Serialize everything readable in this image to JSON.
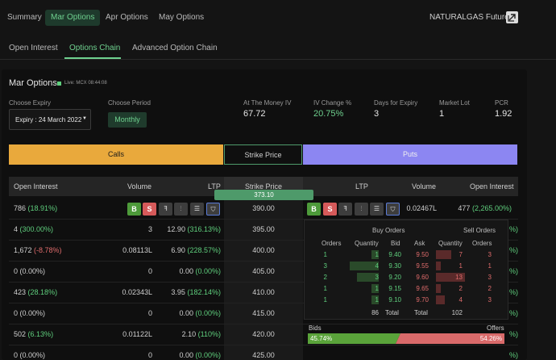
{
  "top_tabs": [
    {
      "label": "Summary"
    },
    {
      "label": "Mar Options"
    },
    {
      "label": "Apr Options"
    },
    {
      "label": "May Options"
    }
  ],
  "instrument": "NATURALGAS Futures",
  "sub_tabs": [
    {
      "label": "Open Interest"
    },
    {
      "label": "Options Chain"
    },
    {
      "label": "Advanced Option Chain"
    }
  ],
  "panel": {
    "title": "Mar Options",
    "live_text": "Live: MCX 08:44:08",
    "choose_expiry_label": "Choose Expiry",
    "expiry_value": "Expiry : 24 March 2022",
    "choose_period_label": "Choose Period",
    "period_value": "Monthly",
    "stats": [
      {
        "label": "At The Money IV",
        "value": "67.72"
      },
      {
        "label": "IV Change %",
        "value": "20.75%"
      },
      {
        "label": "Days for Expiry",
        "value": "3"
      },
      {
        "label": "Market Lot",
        "value": "1"
      },
      {
        "label": "PCR",
        "value": "1.92"
      }
    ]
  },
  "calls_label": "Calls",
  "strike_price_label": "Strike Price",
  "puts_label": "Puts",
  "table_headers": {
    "open_interest": "Open Interest",
    "volume": "Volume",
    "ltp": "LTP",
    "strike": "Strike Price",
    "put_ltp": "LTP",
    "put_volume": "Volume",
    "put_oi": "Open Interest"
  },
  "spot_price": "373.10",
  "row_buttons": {
    "buy": "B",
    "sell": "S"
  },
  "rows": [
    {
      "oi": "786",
      "oi_chg": "(18.91%)",
      "oi_chg_dir": "pos",
      "volume": "",
      "ltp": "",
      "ltp_chg": "",
      "strike": "390.00",
      "put_ltp": "",
      "put_volume": "0.02467L",
      "put_oi": "477",
      "put_oi_chg": "(2,265.00%)"
    },
    {
      "oi": "4",
      "oi_chg": "(300.00%)",
      "oi_chg_dir": "pos",
      "volume": "3",
      "ltp": "12.90",
      "ltp_chg": "(316.13%)",
      "strike": "395.00",
      "put_oi_chg": "%)"
    },
    {
      "oi": "1,672",
      "oi_chg": "(-8.78%)",
      "oi_chg_dir": "neg",
      "volume": "0.08113L",
      "ltp": "6.90",
      "ltp_chg": "(228.57%)",
      "strike": "400.00",
      "put_oi_chg": "%)"
    },
    {
      "oi": "0",
      "oi_chg": "(0.00%)",
      "oi_chg_dir": "none",
      "volume": "0",
      "ltp": "0.00",
      "ltp_chg": "(0.00%)",
      "strike": "405.00",
      "put_oi_chg": "%)"
    },
    {
      "oi": "423",
      "oi_chg": "(28.18%)",
      "oi_chg_dir": "pos",
      "volume": "0.02343L",
      "ltp": "3.95",
      "ltp_chg": "(182.14%)",
      "strike": "410.00",
      "put_oi_chg": "%)"
    },
    {
      "oi": "0",
      "oi_chg": "(0.00%)",
      "oi_chg_dir": "none",
      "volume": "0",
      "ltp": "0.00",
      "ltp_chg": "(0.00%)",
      "strike": "415.00",
      "put_oi_chg": "%)"
    },
    {
      "oi": "502",
      "oi_chg": "(6.13%)",
      "oi_chg_dir": "pos",
      "volume": "0.01122L",
      "ltp": "2.10",
      "ltp_chg": "(110%)",
      "strike": "420.00",
      "put_oi_chg": "%)"
    },
    {
      "oi": "0",
      "oi_chg": "(0.00%)",
      "oi_chg_dir": "none",
      "volume": "0",
      "ltp": "0.00",
      "ltp_chg": "(0.00%)",
      "strike": "425.00",
      "put_oi_chg": "%)"
    }
  ],
  "market_depth": {
    "buy_title": "Buy Orders",
    "sell_title": "Sell Orders",
    "headers": {
      "orders": "Orders",
      "quantity": "Quantity",
      "bid": "Bid",
      "ask": "Ask",
      "sell_quantity": "Quantity",
      "sell_orders": "Orders"
    },
    "levels": [
      {
        "b_orders": "1",
        "b_qty": "1",
        "bid": "9.40",
        "ask": "9.50",
        "s_qty": "7",
        "s_orders": "3"
      },
      {
        "b_orders": "3",
        "b_qty": "4",
        "bid": "9.30",
        "ask": "9.55",
        "s_qty": "1",
        "s_orders": "1"
      },
      {
        "b_orders": "2",
        "b_qty": "3",
        "bid": "9.20",
        "ask": "9.60",
        "s_qty": "13",
        "s_orders": "3"
      },
      {
        "b_orders": "1",
        "b_qty": "1",
        "bid": "9.15",
        "ask": "9.65",
        "s_qty": "2",
        "s_orders": "2"
      },
      {
        "b_orders": "1",
        "b_qty": "1",
        "bid": "9.10",
        "ask": "9.70",
        "s_qty": "4",
        "s_orders": "3"
      }
    ],
    "total_buy_qty": "86",
    "total_label": "Total",
    "total_label_sell": "Total",
    "total_sell_qty": "102",
    "bids_label": "Bids",
    "offers_label": "Offers",
    "bids_pct": "45.74%",
    "offers_pct": "54.26%",
    "bids_fraction": 0.4574
  },
  "colors": {
    "accent_green": "#6fd18f",
    "calls_bg": "#e9a93c",
    "puts_bg": "#8c86f2",
    "buy_btn": "#4d9a3a",
    "sell_btn": "#d65a5a",
    "spot_bar": "#4e9a6a"
  }
}
